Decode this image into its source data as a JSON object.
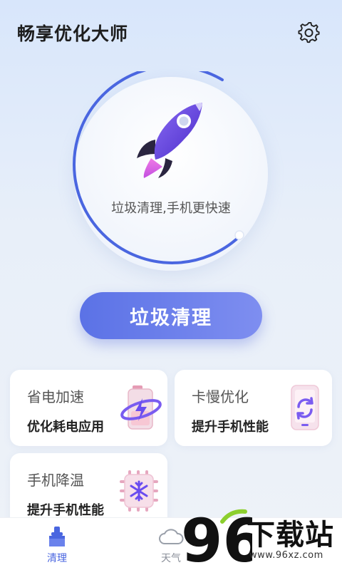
{
  "header": {
    "title": "畅享优化大师",
    "settings_icon": "gear-icon"
  },
  "hero": {
    "caption": "垃圾清理,手机更快速",
    "icon": "rocket-icon",
    "ring_color": "#4a66e0"
  },
  "main_button": {
    "label": "垃圾清理"
  },
  "cards": [
    {
      "title": "省电加速",
      "subtitle": "优化耗电应用",
      "icon": "battery-bolt-icon"
    },
    {
      "title": "卡慢优化",
      "subtitle": "提升手机性能",
      "icon": "phone-refresh-icon"
    },
    {
      "title": "手机降温",
      "subtitle": "提升手机性能",
      "icon": "snowflake-chip-icon"
    }
  ],
  "tabbar": {
    "items": [
      {
        "label": "清理",
        "icon": "broom-icon",
        "active": true
      },
      {
        "label": "天气",
        "icon": "cloud-icon",
        "active": false
      }
    ],
    "active_color": "#4a66e0"
  },
  "watermark": {
    "number": "96",
    "text": "下载站",
    "url": "www.96xz.com"
  }
}
